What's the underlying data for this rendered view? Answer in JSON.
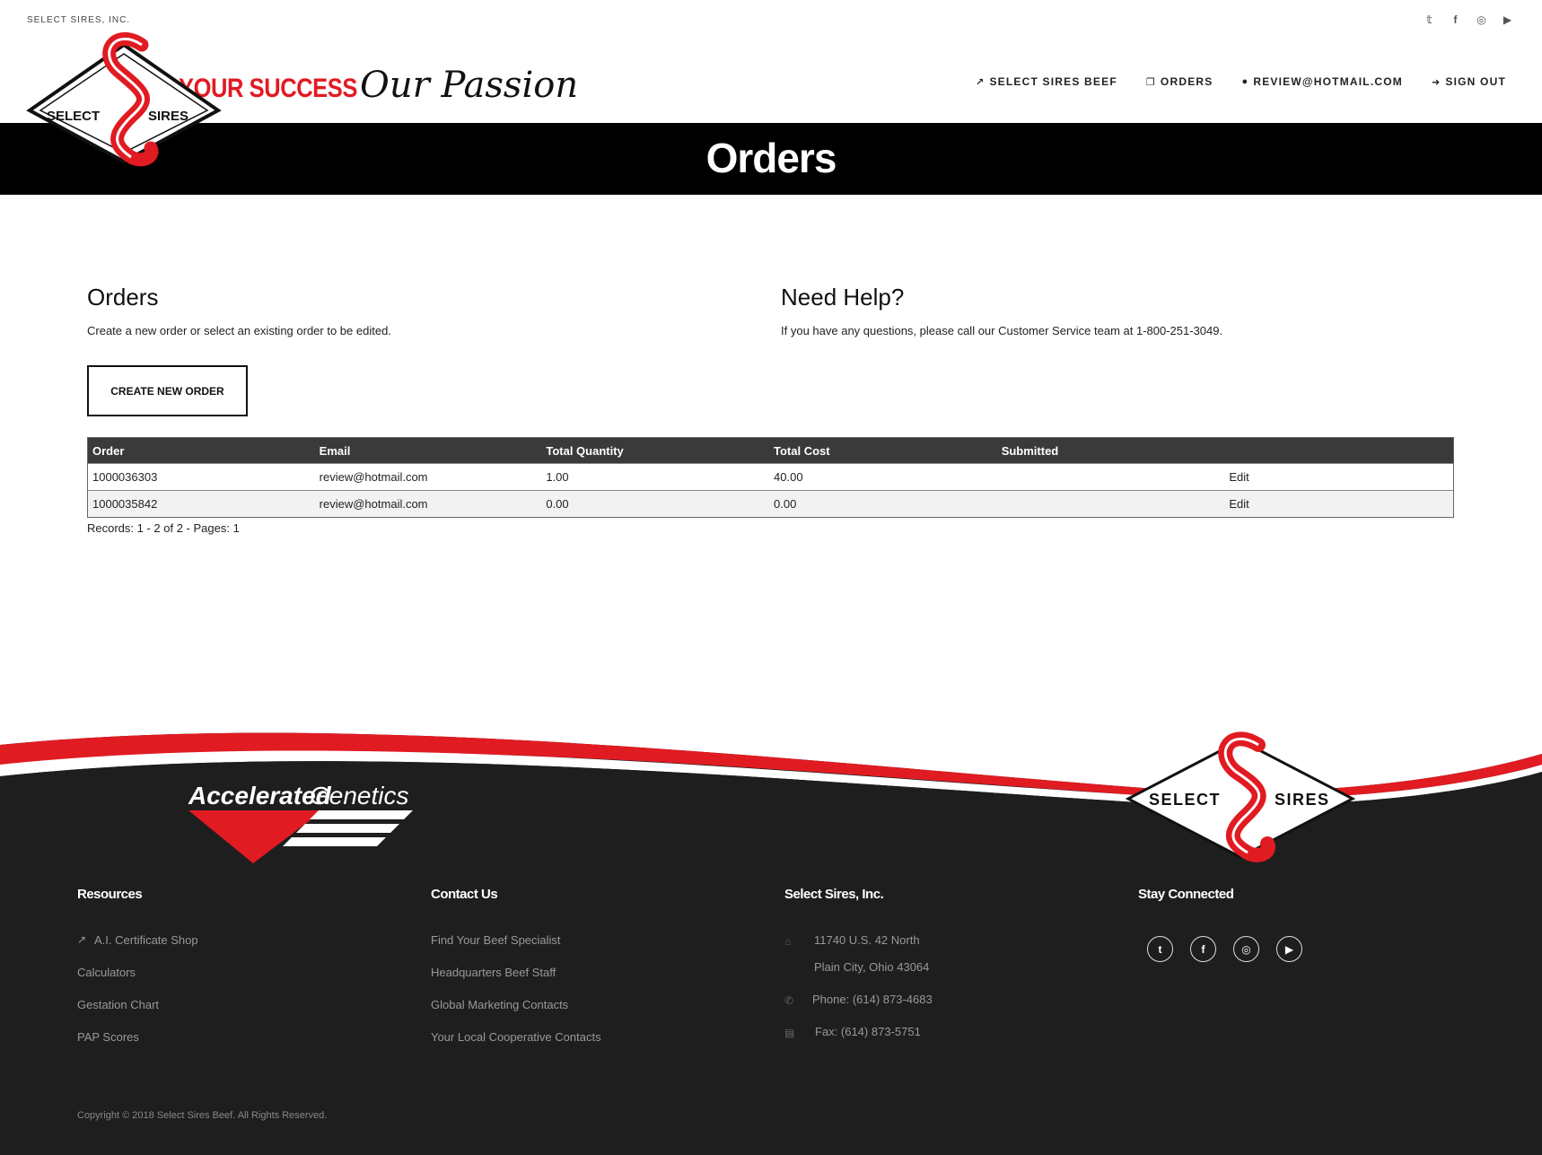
{
  "topbar": {
    "company": "SELECT SIRES, INC.",
    "social": [
      "twitter-icon",
      "facebook-icon",
      "instagram-icon",
      "youtube-icon"
    ]
  },
  "header": {
    "logo_text_left": "SELECT",
    "logo_text_right": "SIRES",
    "tagline_bold": "YOUR SUCCESS",
    "tagline_script": "Our Passion",
    "nav": [
      {
        "label": "SELECT SIRES BEEF",
        "icon": "external-link-icon",
        "glyph": "↗"
      },
      {
        "label": "ORDERS",
        "icon": "copy-icon",
        "glyph": "❐"
      },
      {
        "label": "REVIEW@HOTMAIL.COM",
        "icon": "user-icon",
        "glyph": "●"
      },
      {
        "label": "SIGN OUT",
        "icon": "sign-out-icon",
        "glyph": "➜"
      }
    ]
  },
  "hero": {
    "title": "Orders"
  },
  "orders": {
    "title": "Orders",
    "description": "Create a new order or select an existing order to be edited.",
    "create_button": "CREATE NEW ORDER"
  },
  "help": {
    "title": "Need Help?",
    "description": "If you have any questions, please call our Customer Service team at 1-800-251-3049."
  },
  "table": {
    "headers": [
      "Order",
      "Email",
      "Total Quantity",
      "Total Cost",
      "Submitted",
      ""
    ],
    "rows": [
      {
        "order": "1000036303",
        "email": "review@hotmail.com",
        "quantity": "1.00",
        "cost": "40.00",
        "submitted": "",
        "action": "Edit"
      },
      {
        "order": "1000035842",
        "email": "review@hotmail.com",
        "quantity": "0.00",
        "cost": "0.00",
        "submitted": "",
        "action": "Edit"
      }
    ],
    "records": "Records: 1 - 2 of 2 - Pages: 1"
  },
  "footer": {
    "brand_left": "Accelerated",
    "brand_right": "Genetics",
    "footer_logo_left": "SELECT",
    "footer_logo_right": "SIRES",
    "resources": {
      "heading": "Resources",
      "links": [
        "A.I. Certificate Shop",
        "Calculators",
        "Gestation Chart",
        "PAP Scores"
      ]
    },
    "contact": {
      "heading": "Contact Us",
      "links": [
        "Find Your Beef Specialist",
        "Headquarters Beef Staff",
        "Global Marketing Contacts",
        "Your Local Cooperative Contacts"
      ]
    },
    "company": {
      "heading": "Select Sires, Inc.",
      "address1": "11740 U.S. 42 North",
      "address2": "Plain City, Ohio 43064",
      "phone": "Phone: (614) 873-4683",
      "fax": "Fax: (614) 873-5751"
    },
    "connect": {
      "heading": "Stay Connected",
      "icons": [
        "twitter-icon",
        "facebook-icon",
        "instagram-icon",
        "youtube-icon"
      ]
    },
    "copyright": "Copyright © 2018 Select Sires Beef. All Rights Reserved."
  },
  "colors": {
    "brand_red": "#e11b22",
    "footer_bg": "#1e1e1f",
    "header_bar": "#000000"
  }
}
